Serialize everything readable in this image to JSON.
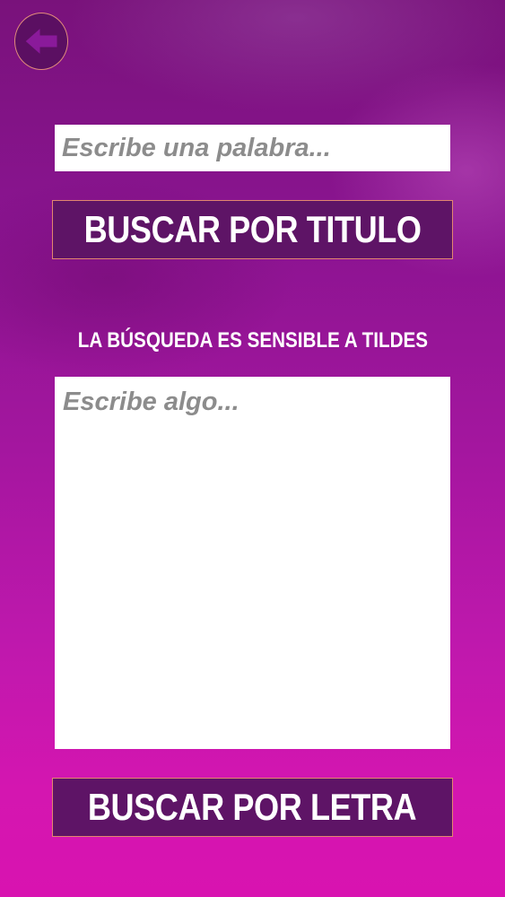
{
  "header": {
    "back_icon": "arrow-left-icon",
    "colors": {
      "circle_fill": "#5b0f62",
      "circle_border": "#e08a7a",
      "arrow": "#8a1a9a"
    }
  },
  "search": {
    "word_placeholder": "Escribe una palabra...",
    "word_value": "",
    "title_button_label": "BUSCAR POR TITULO",
    "notice": "LA BÚSQUEDA ES SENSIBLE A TILDES",
    "text_placeholder": "Escribe algo...",
    "text_value": "",
    "letter_button_label": "BUSCAR POR LETRA"
  },
  "colors": {
    "button_fill": "#5e1466",
    "button_border": "#e2866f",
    "background_top": "#79127b",
    "background_bottom": "#d813b0"
  }
}
